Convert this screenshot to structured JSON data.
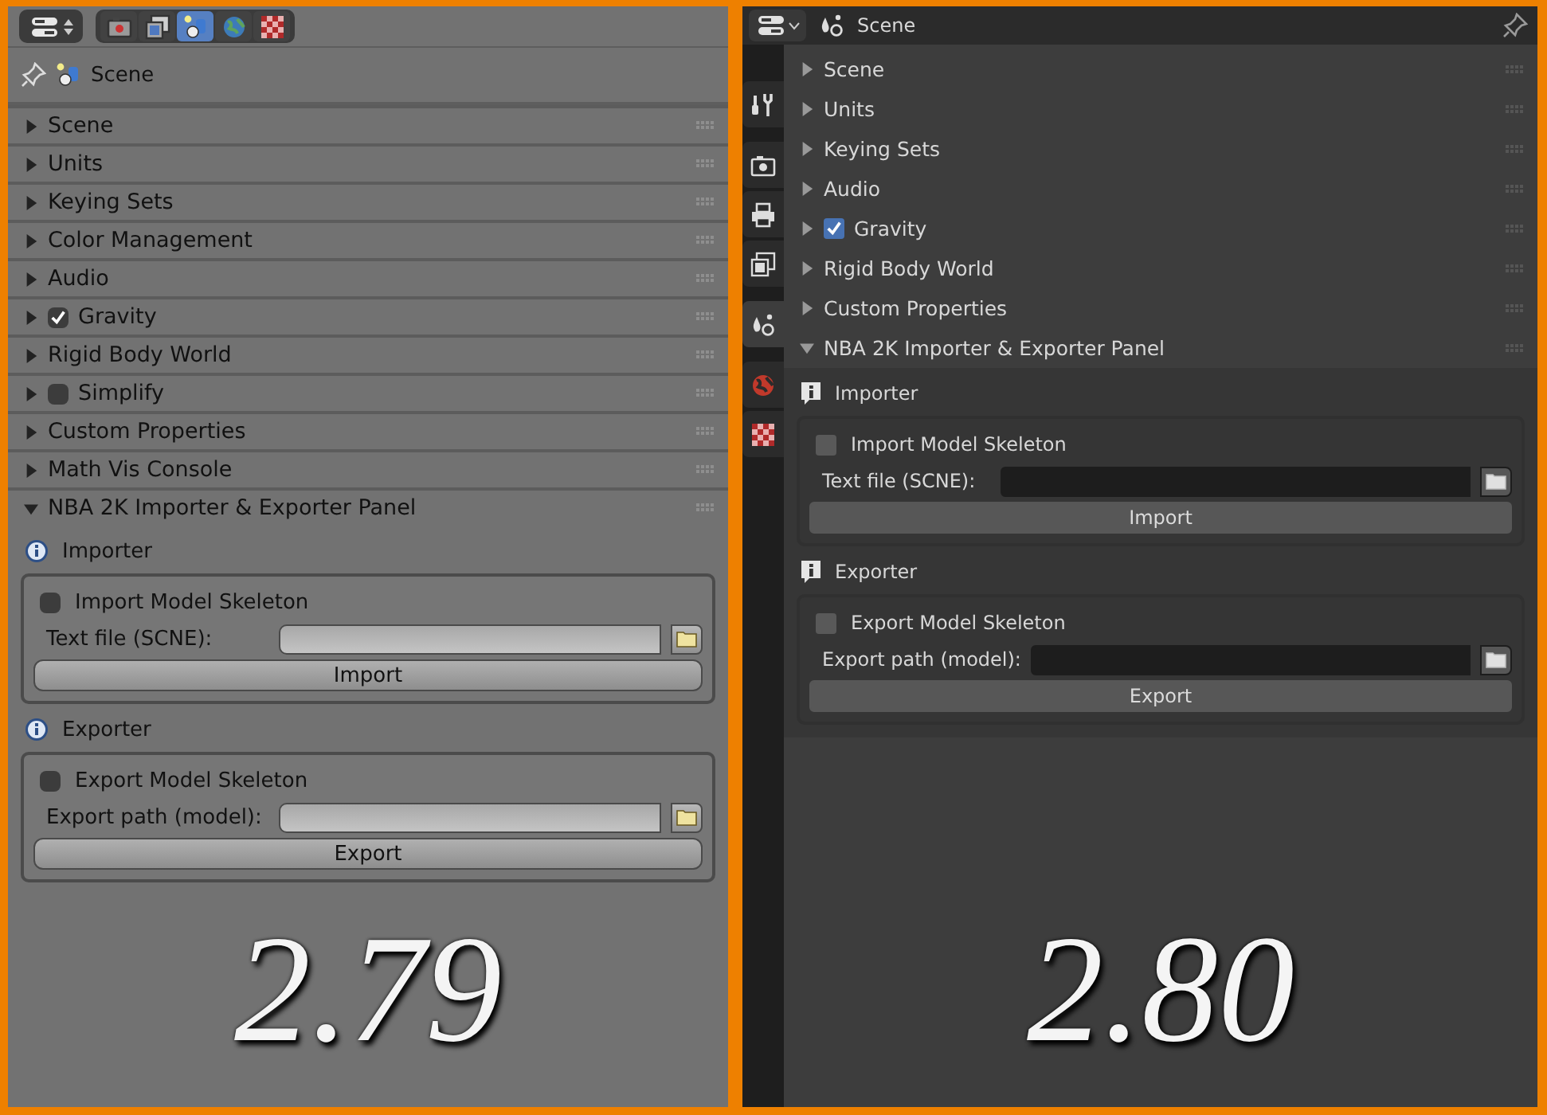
{
  "panels": [
    {
      "kind": "classic",
      "context_tabs": [
        {
          "selected": false
        },
        {
          "selected": false
        },
        {
          "selected": true
        },
        {
          "selected": false
        },
        {
          "selected": false
        }
      ],
      "breadcrumb": "Scene",
      "sections": [
        {
          "kind": "plain",
          "label": "Scene",
          "expanded": false
        },
        {
          "kind": "plain",
          "label": "Units",
          "expanded": false
        },
        {
          "kind": "plain",
          "label": "Keying Sets",
          "expanded": false
        },
        {
          "kind": "plain",
          "label": "Color Management",
          "expanded": false
        },
        {
          "kind": "plain",
          "label": "Audio",
          "expanded": false
        },
        {
          "kind": "toggle",
          "label": "Gravity",
          "expanded": false,
          "checked": true
        },
        {
          "kind": "plain",
          "label": "Rigid Body World",
          "expanded": false
        },
        {
          "kind": "toggle",
          "label": "Simplify",
          "expanded": false,
          "checked": false
        },
        {
          "kind": "plain",
          "label": "Custom Properties",
          "expanded": false
        },
        {
          "kind": "plain",
          "label": "Math Vis Console",
          "expanded": false
        },
        {
          "kind": "plain",
          "label": "NBA 2K Importer & Exporter Panel",
          "expanded": true,
          "subpanels": [
            {
              "title": "Importer",
              "option": {
                "label": "Import Model Skeleton",
                "checked": false
              },
              "field": {
                "label": "Text file (SCNE):"
              },
              "button": "Import"
            },
            {
              "title": "Exporter",
              "option": {
                "label": "Export Model Skeleton",
                "checked": false
              },
              "field": {
                "label": "Export path (model):"
              },
              "button": "Export"
            }
          ]
        }
      ],
      "version": "2.79"
    },
    {
      "kind": "modern",
      "context_tabs": [
        {
          "selected": false
        },
        {
          "selected": false
        },
        {
          "selected": false
        },
        {
          "selected": false
        },
        {
          "selected": true
        },
        {
          "selected": false
        },
        {
          "selected": false
        }
      ],
      "breadcrumb": "Scene",
      "sections": [
        {
          "kind": "plain",
          "label": "Scene",
          "expanded": false
        },
        {
          "kind": "plain",
          "label": "Units",
          "expanded": false
        },
        {
          "kind": "plain",
          "label": "Keying Sets",
          "expanded": false
        },
        {
          "kind": "plain",
          "label": "Audio",
          "expanded": false
        },
        {
          "kind": "toggle",
          "label": "Gravity",
          "expanded": false,
          "checked": true
        },
        {
          "kind": "plain",
          "label": "Rigid Body World",
          "expanded": false
        },
        {
          "kind": "plain",
          "label": "Custom Properties",
          "expanded": false
        },
        {
          "kind": "plain",
          "label": "NBA 2K Importer & Exporter Panel",
          "expanded": true,
          "subpanels": [
            {
              "title": "Importer",
              "option": {
                "label": "Import Model Skeleton",
                "checked": false
              },
              "field": {
                "label": "Text file (SCNE):"
              },
              "button": "Import"
            },
            {
              "title": "Exporter",
              "option": {
                "label": "Export Model Skeleton",
                "checked": false
              },
              "field": {
                "label": "Export path (model):"
              },
              "button": "Export"
            }
          ]
        }
      ],
      "version": "2.80"
    }
  ]
}
